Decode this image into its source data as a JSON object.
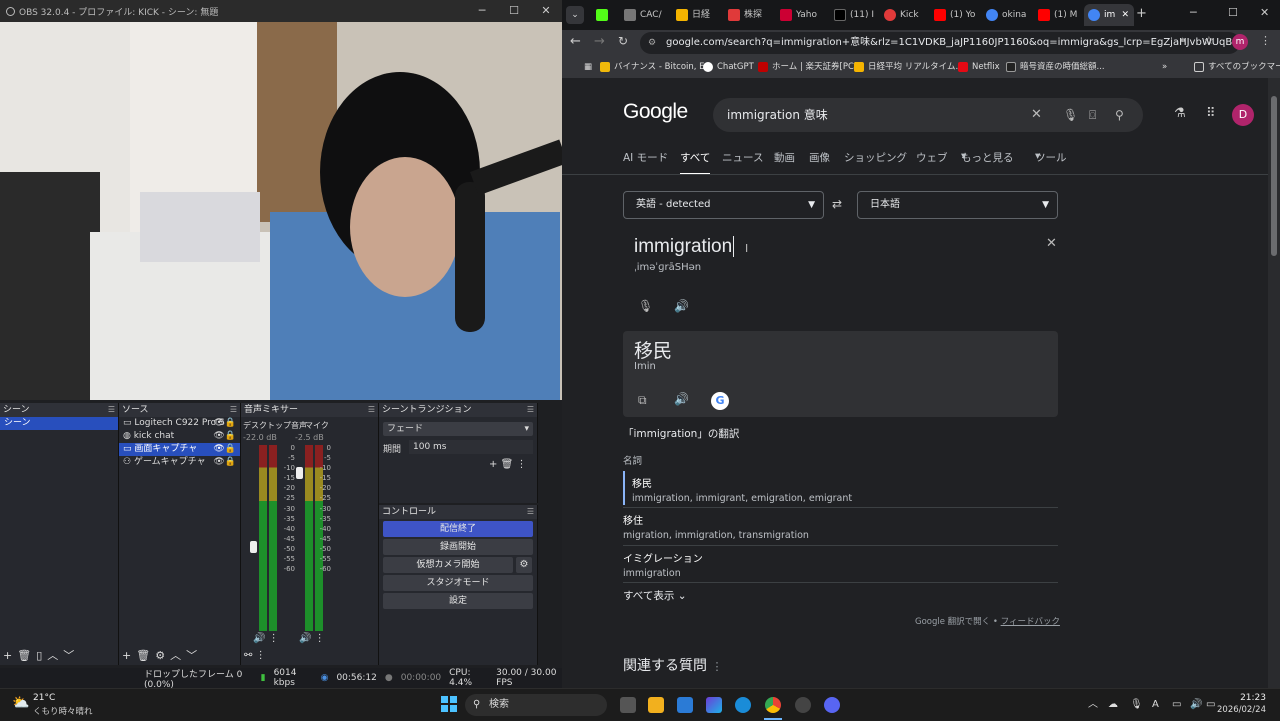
{
  "obs": {
    "title": "OBS 32.0.4 - プロファイル: KICK - シーン: 無題",
    "scenes_header": "シーン",
    "scenes": [
      "シーン"
    ],
    "sources_header": "ソース",
    "sources": [
      "Logitech C922 Pro S",
      "kick chat",
      "画面キャプチャ",
      "ゲームキャプチャ"
    ],
    "mixer_header": "音声ミキサー",
    "mixer_desktop_label": "デスクトップ音声",
    "mixer_desktop_db": "-22.0 dB",
    "mixer_mic_label": "マイク",
    "mixer_mic_db": "-2.5 dB",
    "meter_scale": [
      "0",
      "-5",
      "-10",
      "-15",
      "-20",
      "-25",
      "-30",
      "-35",
      "-40",
      "-45",
      "-50",
      "-55",
      "-60"
    ],
    "meter_scale_left": [
      "0",
      "-5",
      "-10",
      "-15",
      "-20",
      "-25",
      "-30",
      "-35",
      "-40",
      "-45",
      "-50",
      "-55",
      "-60"
    ],
    "transition_header": "シーントランジション",
    "transition_value": "フェード",
    "duration_label": "期間",
    "duration_value": "100 ms",
    "controls_header": "コントロール",
    "controls": [
      "配信終了",
      "録画開始",
      "仮想カメラ開始",
      "スタジオモード",
      "設定"
    ],
    "status_dropped": "ドロップしたフレーム 0 (0.0%)",
    "status_kbps": "6014 kbps",
    "status_stream_time": "00:56:12",
    "status_rec_time": "00:00:00",
    "status_cpu": "CPU: 4.4%",
    "status_fps": "30.00 / 30.00 FPS"
  },
  "chrome": {
    "tabs": [
      {
        "label": "",
        "color": "#53fc18"
      },
      {
        "label": "CAC/",
        "color": "#777777"
      },
      {
        "label": "日経",
        "color": "#f5b400"
      },
      {
        "label": "株探",
        "color": "#e03a3a"
      },
      {
        "label": "Yaho",
        "color": "#cc0033"
      },
      {
        "label": "(11) I",
        "color": "#000000"
      },
      {
        "label": "Kick",
        "color": "#e03a3a"
      },
      {
        "label": "(1) Yo",
        "color": "#ff0000"
      },
      {
        "label": "okina",
        "color": "#4285f4"
      },
      {
        "label": "(1) M",
        "color": "#ff0000"
      },
      {
        "label": "im",
        "color": "#4285f4"
      }
    ],
    "url": "google.com/search?q=immigration+意味&rlz=1C1VDKB_jaJP1160JP1160&oq=immigra&gs_lcrp=EgZjaHJvbWUqBwgCE...",
    "profile_initial": "m",
    "bookmarks": [
      "バイナンス - Bitcoin, E...",
      "ChatGPT",
      "ホーム | 楽天証券[PC]",
      "日経平均 リアルタイム...",
      "Netflix",
      "暗号資産の時価総額..."
    ],
    "all_bookmarks": "すべてのブックマーク"
  },
  "google": {
    "logo": "Google",
    "query": "immigration 意味",
    "tabs": [
      "AI モード",
      "すべて",
      "ニュース",
      "動画",
      "画像",
      "ショッピング",
      "ウェブ",
      "もっと見る",
      "ツール"
    ],
    "avatar": "D",
    "source_lang": "英語 - detected",
    "target_lang": "日本語",
    "source_text": "immigration",
    "phonetic": "ˌiməˈɡrāSHən",
    "translation": "移民",
    "romanization": "Imin",
    "defs_title": "「immigration」の翻訳",
    "pos": "名詞",
    "entries": [
      {
        "word": "移民",
        "syn": "immigration, immigrant, emigration, emigrant"
      },
      {
        "word": "移住",
        "syn": "migration, immigration, transmigration"
      },
      {
        "word": "イミグレーション",
        "syn": "immigration"
      }
    ],
    "show_all": "すべて表示",
    "footer_open": "Google 翻訳で開く",
    "footer_feedback": "フィードバック",
    "related": "関連する質問"
  },
  "taskbar": {
    "weather_temp": "21°C",
    "weather_desc": "くもり時々晴れ",
    "search": "検索",
    "time": "21:23",
    "date": "2026/02/24"
  }
}
